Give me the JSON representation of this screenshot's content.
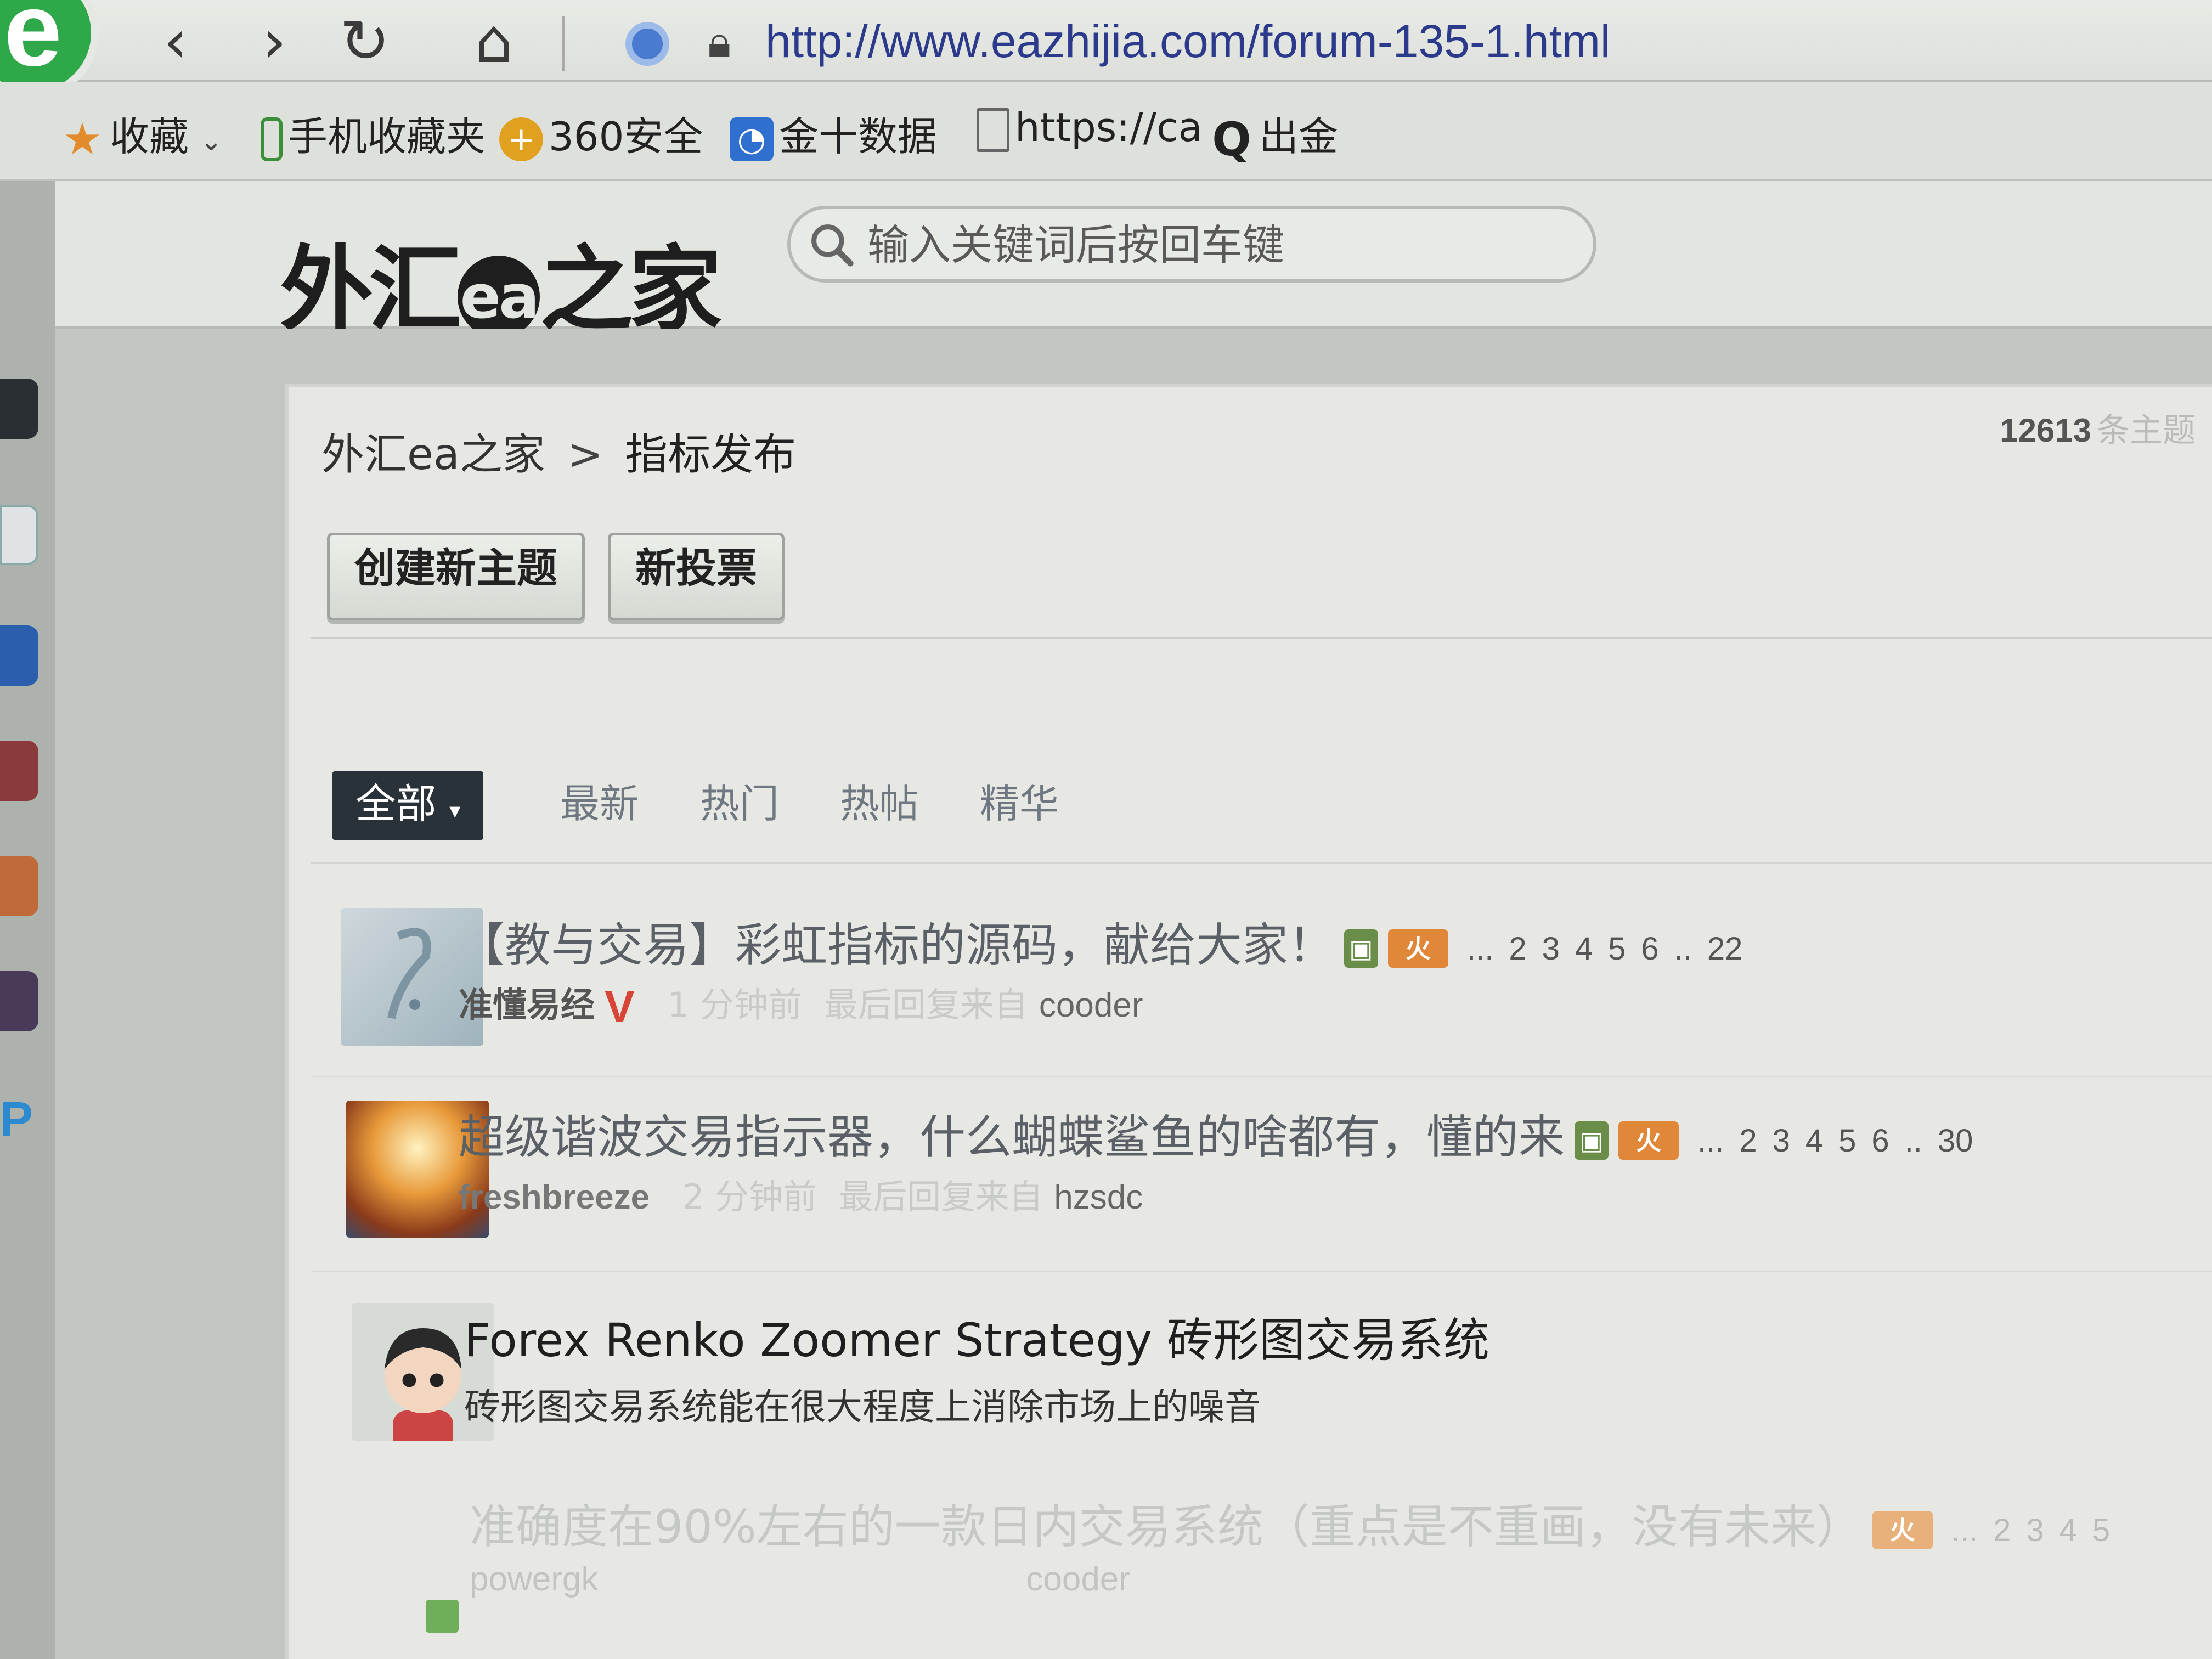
{
  "browser": {
    "logo_letter": "e",
    "url": "http://www.eazhijia.com/forum-135-1.html",
    "nav": {
      "back": "‹",
      "forward": "›",
      "reload": "↻",
      "home": "⌂"
    },
    "bookmarks": [
      {
        "label": "收藏",
        "icon": "star-icon",
        "color": "#e28b2c"
      },
      {
        "label": "手机收藏夹",
        "icon": "phone-icon",
        "color": "#3b8f3b"
      },
      {
        "label": "360安全",
        "icon": "shield-plus-icon",
        "color": "#e0a020"
      },
      {
        "label": "金十数据",
        "icon": "jin10-icon",
        "color": "#2e6fd0"
      },
      {
        "label": "https://ca",
        "icon": "page-icon",
        "color": "#777777"
      },
      {
        "label": "出金",
        "icon": "q-icon",
        "color": "#222222"
      }
    ]
  },
  "site": {
    "logo_left": "外汇",
    "logo_ea": "ea",
    "logo_right": "之家",
    "search_placeholder": "输入关键词后按回车键"
  },
  "forum": {
    "breadcrumb_home": "外汇ea之家",
    "breadcrumb_sep": ">",
    "breadcrumb_current": "指标发布",
    "thread_count": "12613",
    "thread_count_label": "条主题",
    "new_thread_label": "创建新主题",
    "new_poll_label": "新投票",
    "filter_all": "全部",
    "filters": [
      "最新",
      "热门",
      "热帖",
      "精华"
    ]
  },
  "threads": [
    {
      "title": "【教与交易】彩虹指标的源码，献给大家！",
      "pages": [
        "...",
        "2",
        "3",
        "4",
        "5",
        "6",
        "..",
        "22"
      ],
      "author": "准懂易经",
      "vip": "V",
      "time": "1 分钟前",
      "last_label": "最后回复来自",
      "last_user": "cooder",
      "hot_label": "火"
    },
    {
      "title": "超级谐波交易指示器，什么蝴蝶鲨鱼的啥都有，懂的来",
      "pages": [
        "...",
        "2",
        "3",
        "4",
        "5",
        "6",
        "..",
        "30"
      ],
      "author": "freshbreeze",
      "time": "2 分钟前",
      "last_label": "最后回复来自",
      "last_user": "hzsdc",
      "hot_label": "火"
    },
    {
      "title": "Forex Renko Zoomer Strategy 砖形图交易系统",
      "desc": "砖形图交易系统能在很大程度上消除市场上的噪音"
    },
    {
      "title": "准确度在90%左右的一款日内交易系统（重点是不重画，没有未来）",
      "pages": [
        "...",
        "2",
        "3",
        "4",
        "5"
      ],
      "author": "powergk",
      "last_user": "cooder",
      "hot_label": "火"
    }
  ],
  "colors": {
    "accent_dark": "#283238",
    "hot_badge": "#e0873a",
    "vip": "#d64537",
    "url": "#2c3a8c"
  }
}
